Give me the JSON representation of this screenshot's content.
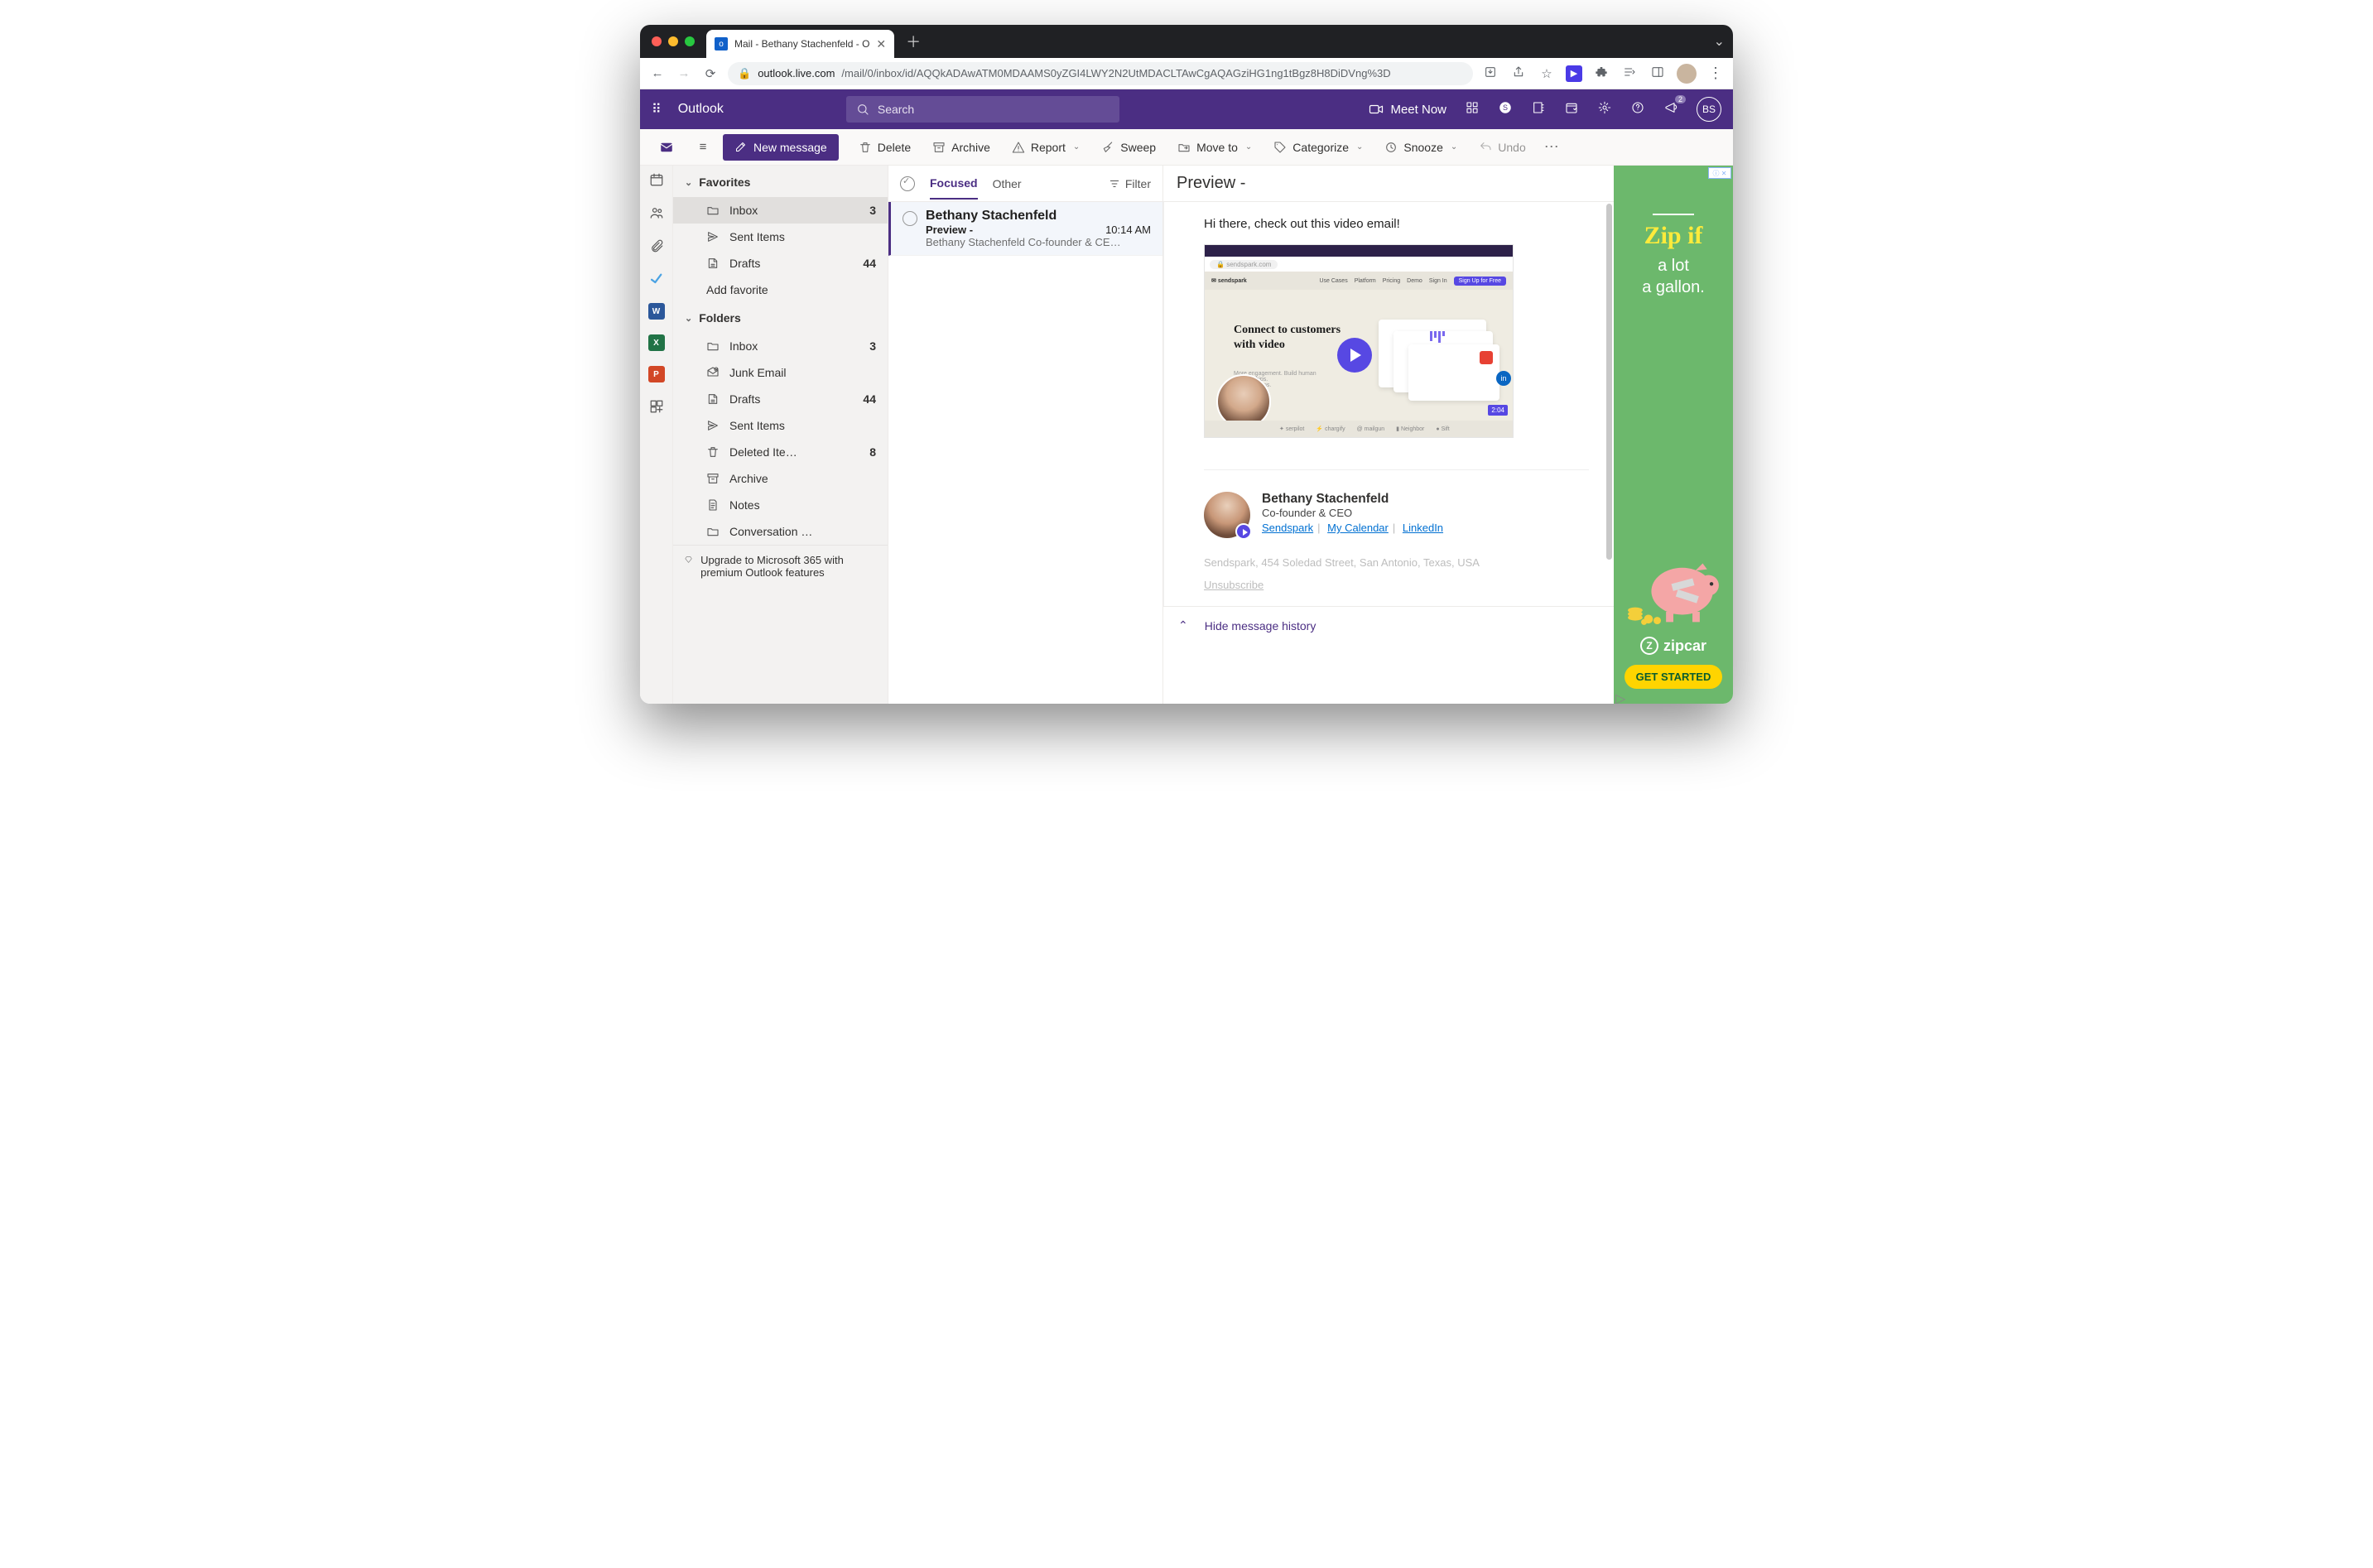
{
  "browser": {
    "tab_title": "Mail - Bethany Stachenfeld - O",
    "url_host": "outlook.live.com",
    "url_path": "/mail/0/inbox/id/AQQkADAwATM0MDAAMS0yZGI4LWY2N2UtMDACLTAwCgAQAGziHG1ng1tBgz8H8DiDVng%3D"
  },
  "header": {
    "brand": "Outlook",
    "search_placeholder": "Search",
    "meet_now": "Meet Now",
    "initials": "BS",
    "badge": "2"
  },
  "cmd": {
    "new_message": "New message",
    "delete": "Delete",
    "archive": "Archive",
    "report": "Report",
    "sweep": "Sweep",
    "move_to": "Move to",
    "categorize": "Categorize",
    "snooze": "Snooze",
    "undo": "Undo"
  },
  "nav": {
    "favorites_hdr": "Favorites",
    "folders_hdr": "Folders",
    "favorites": [
      {
        "label": "Inbox",
        "count": "3"
      },
      {
        "label": "Sent Items",
        "count": ""
      },
      {
        "label": "Drafts",
        "count": "44"
      }
    ],
    "add_favorite": "Add favorite",
    "folders": [
      {
        "label": "Inbox",
        "count": "3"
      },
      {
        "label": "Junk Email",
        "count": ""
      },
      {
        "label": "Drafts",
        "count": "44"
      },
      {
        "label": "Sent Items",
        "count": ""
      },
      {
        "label": "Deleted Ite…",
        "count": "8"
      },
      {
        "label": "Archive",
        "count": ""
      },
      {
        "label": "Notes",
        "count": ""
      },
      {
        "label": "Conversation …",
        "count": ""
      }
    ],
    "upgrade": "Upgrade to Microsoft 365 with premium Outlook features"
  },
  "list": {
    "tab_focused": "Focused",
    "tab_other": "Other",
    "filter": "Filter",
    "msgs": [
      {
        "from": "Bethany Stachenfeld",
        "subject": "Preview -",
        "time": "10:14 AM",
        "preview": "Bethany Stachenfeld Co-founder & CE…"
      }
    ]
  },
  "reading": {
    "title": "Preview -",
    "body_line": "Hi there, check out this video email!",
    "video": {
      "url_text": "sendspark.com",
      "brand": "sendspark",
      "menu": [
        "Use Cases",
        "Platform",
        "Pricing",
        "Demo",
        "Sign In"
      ],
      "cta": "Sign Up for Free",
      "headline": "Connect to customers with video",
      "logos": [
        "serpilot",
        "chargify",
        "mailgun",
        "Neighbor",
        "Sift"
      ],
      "duration": "2:04"
    },
    "sig": {
      "name": "Bethany Stachenfeld",
      "title": "Co-founder & CEO",
      "links": [
        "Sendspark",
        "My Calendar",
        "LinkedIn"
      ]
    },
    "address": "Sendspark, 454 Soledad Street, San Antonio, Texas, USA",
    "unsubscribe": "Unsubscribe",
    "hide_history": "Hide message history"
  },
  "ad": {
    "title": "Zip if",
    "sub1": "a lot",
    "sub2": "a gallon.",
    "brand": "zipcar",
    "cta": "GET STARTED"
  }
}
